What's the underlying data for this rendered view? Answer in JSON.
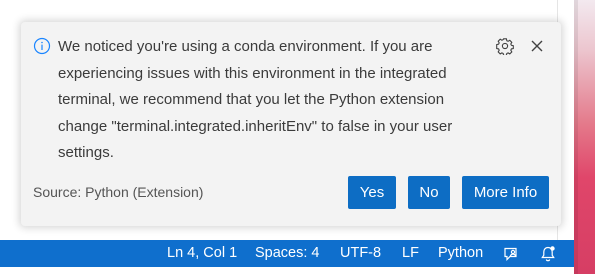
{
  "notification": {
    "icon": "info-icon",
    "message": "We noticed you're using a conda environment. If you are experiencing issues with this environment in the integrated terminal, we recommend that you let the Python extension change \"terminal.integrated.inheritEnv\" to false in your user settings.",
    "source": "Source: Python (Extension)",
    "actions": {
      "settings_icon": "gear-icon",
      "close_icon": "close-icon"
    },
    "buttons": {
      "yes": "Yes",
      "no": "No",
      "more_info": "More Info"
    }
  },
  "statusbar": {
    "cursor_position": "Ln 4, Col 1",
    "indentation": "Spaces: 4",
    "encoding": "UTF-8",
    "line_ending": "LF",
    "language": "Python",
    "feedback_icon": "feedback-icon",
    "notifications_icon": "bell-icon"
  },
  "colors": {
    "accent": "#0f6fcd",
    "button": "#0d6dc4",
    "toast_background": "#f3f3f3",
    "info": "#1a85ff"
  }
}
